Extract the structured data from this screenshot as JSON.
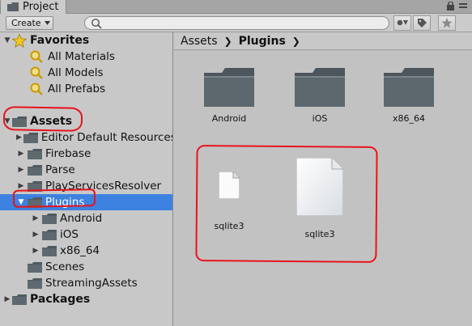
{
  "tab": {
    "label": "Project"
  },
  "toolbar": {
    "create_label": "Create",
    "search_value": ""
  },
  "tree": {
    "favorites": {
      "label": "Favorites",
      "items": [
        "All Materials",
        "All Models",
        "All Prefabs"
      ]
    },
    "assets": {
      "label": "Assets"
    },
    "asset_children": [
      "Editor Default Resources",
      "Firebase",
      "Parse",
      "PlayServicesResolver"
    ],
    "plugins": {
      "label": "Plugins",
      "children": [
        "Android",
        "iOS",
        "x86_64"
      ]
    },
    "asset_tail": [
      "Scenes",
      "StreamingAssets"
    ],
    "packages": {
      "label": "Packages"
    }
  },
  "breadcrumb": {
    "root": "Assets",
    "current": "Plugins"
  },
  "grid": {
    "folders": [
      "Android",
      "iOS",
      "x86_64"
    ],
    "files": [
      "sqlite3",
      "sqlite3"
    ]
  },
  "colors": {
    "selection": "#3d82e0",
    "annotation": "#e8131b",
    "folder": "#4f5a60"
  }
}
